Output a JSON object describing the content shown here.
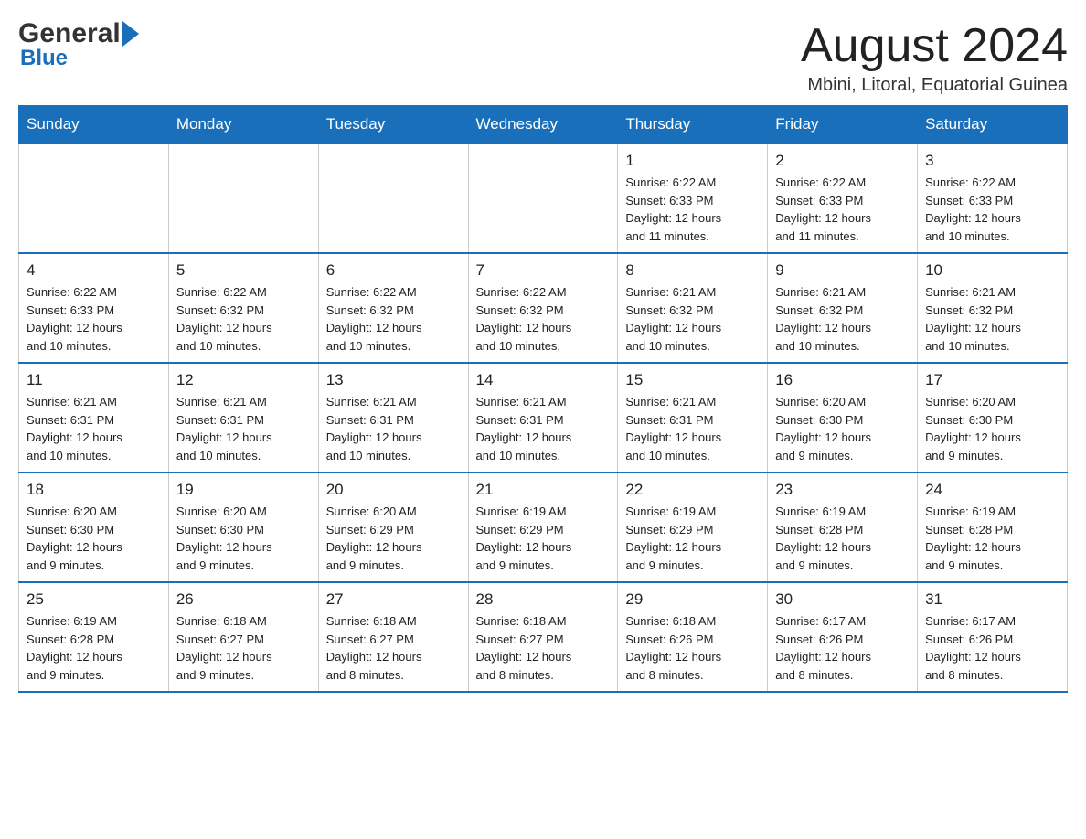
{
  "header": {
    "logo_general": "General",
    "logo_blue": "Blue",
    "month_title": "August 2024",
    "subtitle": "Mbini, Litoral, Equatorial Guinea"
  },
  "calendar": {
    "days_of_week": [
      "Sunday",
      "Monday",
      "Tuesday",
      "Wednesday",
      "Thursday",
      "Friday",
      "Saturday"
    ],
    "weeks": [
      [
        {
          "day": "",
          "info": ""
        },
        {
          "day": "",
          "info": ""
        },
        {
          "day": "",
          "info": ""
        },
        {
          "day": "",
          "info": ""
        },
        {
          "day": "1",
          "info": "Sunrise: 6:22 AM\nSunset: 6:33 PM\nDaylight: 12 hours\nand 11 minutes."
        },
        {
          "day": "2",
          "info": "Sunrise: 6:22 AM\nSunset: 6:33 PM\nDaylight: 12 hours\nand 11 minutes."
        },
        {
          "day": "3",
          "info": "Sunrise: 6:22 AM\nSunset: 6:33 PM\nDaylight: 12 hours\nand 10 minutes."
        }
      ],
      [
        {
          "day": "4",
          "info": "Sunrise: 6:22 AM\nSunset: 6:33 PM\nDaylight: 12 hours\nand 10 minutes."
        },
        {
          "day": "5",
          "info": "Sunrise: 6:22 AM\nSunset: 6:32 PM\nDaylight: 12 hours\nand 10 minutes."
        },
        {
          "day": "6",
          "info": "Sunrise: 6:22 AM\nSunset: 6:32 PM\nDaylight: 12 hours\nand 10 minutes."
        },
        {
          "day": "7",
          "info": "Sunrise: 6:22 AM\nSunset: 6:32 PM\nDaylight: 12 hours\nand 10 minutes."
        },
        {
          "day": "8",
          "info": "Sunrise: 6:21 AM\nSunset: 6:32 PM\nDaylight: 12 hours\nand 10 minutes."
        },
        {
          "day": "9",
          "info": "Sunrise: 6:21 AM\nSunset: 6:32 PM\nDaylight: 12 hours\nand 10 minutes."
        },
        {
          "day": "10",
          "info": "Sunrise: 6:21 AM\nSunset: 6:32 PM\nDaylight: 12 hours\nand 10 minutes."
        }
      ],
      [
        {
          "day": "11",
          "info": "Sunrise: 6:21 AM\nSunset: 6:31 PM\nDaylight: 12 hours\nand 10 minutes."
        },
        {
          "day": "12",
          "info": "Sunrise: 6:21 AM\nSunset: 6:31 PM\nDaylight: 12 hours\nand 10 minutes."
        },
        {
          "day": "13",
          "info": "Sunrise: 6:21 AM\nSunset: 6:31 PM\nDaylight: 12 hours\nand 10 minutes."
        },
        {
          "day": "14",
          "info": "Sunrise: 6:21 AM\nSunset: 6:31 PM\nDaylight: 12 hours\nand 10 minutes."
        },
        {
          "day": "15",
          "info": "Sunrise: 6:21 AM\nSunset: 6:31 PM\nDaylight: 12 hours\nand 10 minutes."
        },
        {
          "day": "16",
          "info": "Sunrise: 6:20 AM\nSunset: 6:30 PM\nDaylight: 12 hours\nand 9 minutes."
        },
        {
          "day": "17",
          "info": "Sunrise: 6:20 AM\nSunset: 6:30 PM\nDaylight: 12 hours\nand 9 minutes."
        }
      ],
      [
        {
          "day": "18",
          "info": "Sunrise: 6:20 AM\nSunset: 6:30 PM\nDaylight: 12 hours\nand 9 minutes."
        },
        {
          "day": "19",
          "info": "Sunrise: 6:20 AM\nSunset: 6:30 PM\nDaylight: 12 hours\nand 9 minutes."
        },
        {
          "day": "20",
          "info": "Sunrise: 6:20 AM\nSunset: 6:29 PM\nDaylight: 12 hours\nand 9 minutes."
        },
        {
          "day": "21",
          "info": "Sunrise: 6:19 AM\nSunset: 6:29 PM\nDaylight: 12 hours\nand 9 minutes."
        },
        {
          "day": "22",
          "info": "Sunrise: 6:19 AM\nSunset: 6:29 PM\nDaylight: 12 hours\nand 9 minutes."
        },
        {
          "day": "23",
          "info": "Sunrise: 6:19 AM\nSunset: 6:28 PM\nDaylight: 12 hours\nand 9 minutes."
        },
        {
          "day": "24",
          "info": "Sunrise: 6:19 AM\nSunset: 6:28 PM\nDaylight: 12 hours\nand 9 minutes."
        }
      ],
      [
        {
          "day": "25",
          "info": "Sunrise: 6:19 AM\nSunset: 6:28 PM\nDaylight: 12 hours\nand 9 minutes."
        },
        {
          "day": "26",
          "info": "Sunrise: 6:18 AM\nSunset: 6:27 PM\nDaylight: 12 hours\nand 9 minutes."
        },
        {
          "day": "27",
          "info": "Sunrise: 6:18 AM\nSunset: 6:27 PM\nDaylight: 12 hours\nand 8 minutes."
        },
        {
          "day": "28",
          "info": "Sunrise: 6:18 AM\nSunset: 6:27 PM\nDaylight: 12 hours\nand 8 minutes."
        },
        {
          "day": "29",
          "info": "Sunrise: 6:18 AM\nSunset: 6:26 PM\nDaylight: 12 hours\nand 8 minutes."
        },
        {
          "day": "30",
          "info": "Sunrise: 6:17 AM\nSunset: 6:26 PM\nDaylight: 12 hours\nand 8 minutes."
        },
        {
          "day": "31",
          "info": "Sunrise: 6:17 AM\nSunset: 6:26 PM\nDaylight: 12 hours\nand 8 minutes."
        }
      ]
    ]
  }
}
